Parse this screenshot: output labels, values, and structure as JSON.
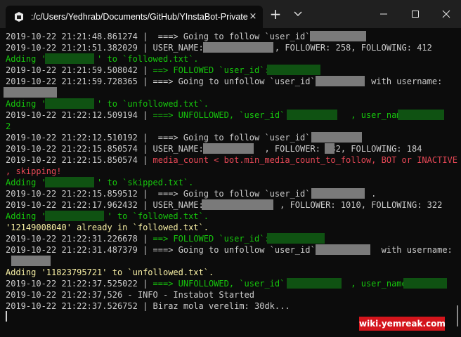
{
  "window": {
    "tab_title": ":/c/Users/Yedhrab/Documents/GitHub/YInstaBot-Private",
    "tab_close": "×",
    "new_tab": "+",
    "dropdown": "⌄",
    "minimize": "—",
    "maximize": "☐",
    "close": "✕"
  },
  "terminal": {
    "lines": [
      {
        "text": "2019-10-22 21:21:48.861274 |  ===> Going to follow `user_id`: ",
        "color": "w"
      },
      {
        "text": "2019-10-22 21:21:51.382029 | USER_NAME:              , FOLLOWER: 258, FOLLOWING: 412",
        "color": "w"
      },
      {
        "text": "Adding '          ' to `followed.txt`.",
        "color": "g"
      },
      {
        "text": "2019-10-22 21:21:59.508042 | ==> FOLLOWED `user_id`: ",
        "color": "g",
        "prefix": "2019-10-22 21:21:59.508042 | "
      },
      {
        "text": "2019-10-22 21:21:59.728365 | ===> Going to unfollow `user_id`:          with username:",
        "color": "w"
      },
      {
        "text": "",
        "color": "w"
      },
      {
        "text": "Adding '          ' to `unfollowed.txt`.",
        "color": "g"
      },
      {
        "text": "2019-10-22 21:22:12.509194 | ===> UNFOLLOWED, `user_id`:            , user_name:",
        "color": "g",
        "prefix": "2019-10-22 21:22:12.509194 | "
      },
      {
        "text": "2",
        "color": "g"
      },
      {
        "text": "2019-10-22 21:22:12.510192 |  ===> Going to follow `user_id`: ",
        "color": "w"
      },
      {
        "text": "2019-10-22 21:22:15.850574 | USER_NAME:            , FOLLOWER: 332, FOLLOWING: 184",
        "color": "w"
      },
      {
        "text": "2019-10-22 21:22:15.850574 | media_count < bot.min_media_count_to_follow, BOT or INACTIVE",
        "color": "r",
        "prefix": "2019-10-22 21:22:15.850574 | "
      },
      {
        "text": ", skipping!",
        "color": "r"
      },
      {
        "text": "Adding '          ' to `skipped.txt`.",
        "color": "g"
      },
      {
        "text": "2019-10-22 21:22:15.859512 |  ===> Going to follow `user_id`:           .",
        "color": "w"
      },
      {
        "text": "2019-10-22 21:22:17.962432 | USER_NAME:               , FOLLOWER: 1010, FOLLOWING: 322",
        "color": "w"
      },
      {
        "text": "Adding '            ' to `followed.txt`.",
        "color": "g"
      },
      {
        "text": "'12149008040' already in `followed.txt`.",
        "color": "y"
      },
      {
        "text": "2019-10-22 21:22:31.226678 | ==> FOLLOWED `user_id`: ",
        "color": "g",
        "prefix": "2019-10-22 21:22:31.226678 | "
      },
      {
        "text": "2019-10-22 21:22:31.487379 | ===> Going to unfollow `user_id`:            with username:",
        "color": "w"
      },
      {
        "text": "",
        "color": "w"
      },
      {
        "text": "Adding '11823795721' to `unfollowed.txt`.",
        "color": "y"
      },
      {
        "text": "2019-10-22 21:22:37.525022 | ===> UNFOLLOWED, `user_id`:            , user_name:",
        "color": "g",
        "prefix": "2019-10-22 21:22:37.525022 | "
      },
      {
        "text": "2019-10-22 21:22:37,526 - INFO - Instabot Started",
        "color": "w"
      },
      {
        "text": "2019-10-22 21:22:37.526752 | Biraz mola verelim: 30dk...",
        "color": "w"
      }
    ]
  },
  "watermark": "wiki.yemreak.com"
}
